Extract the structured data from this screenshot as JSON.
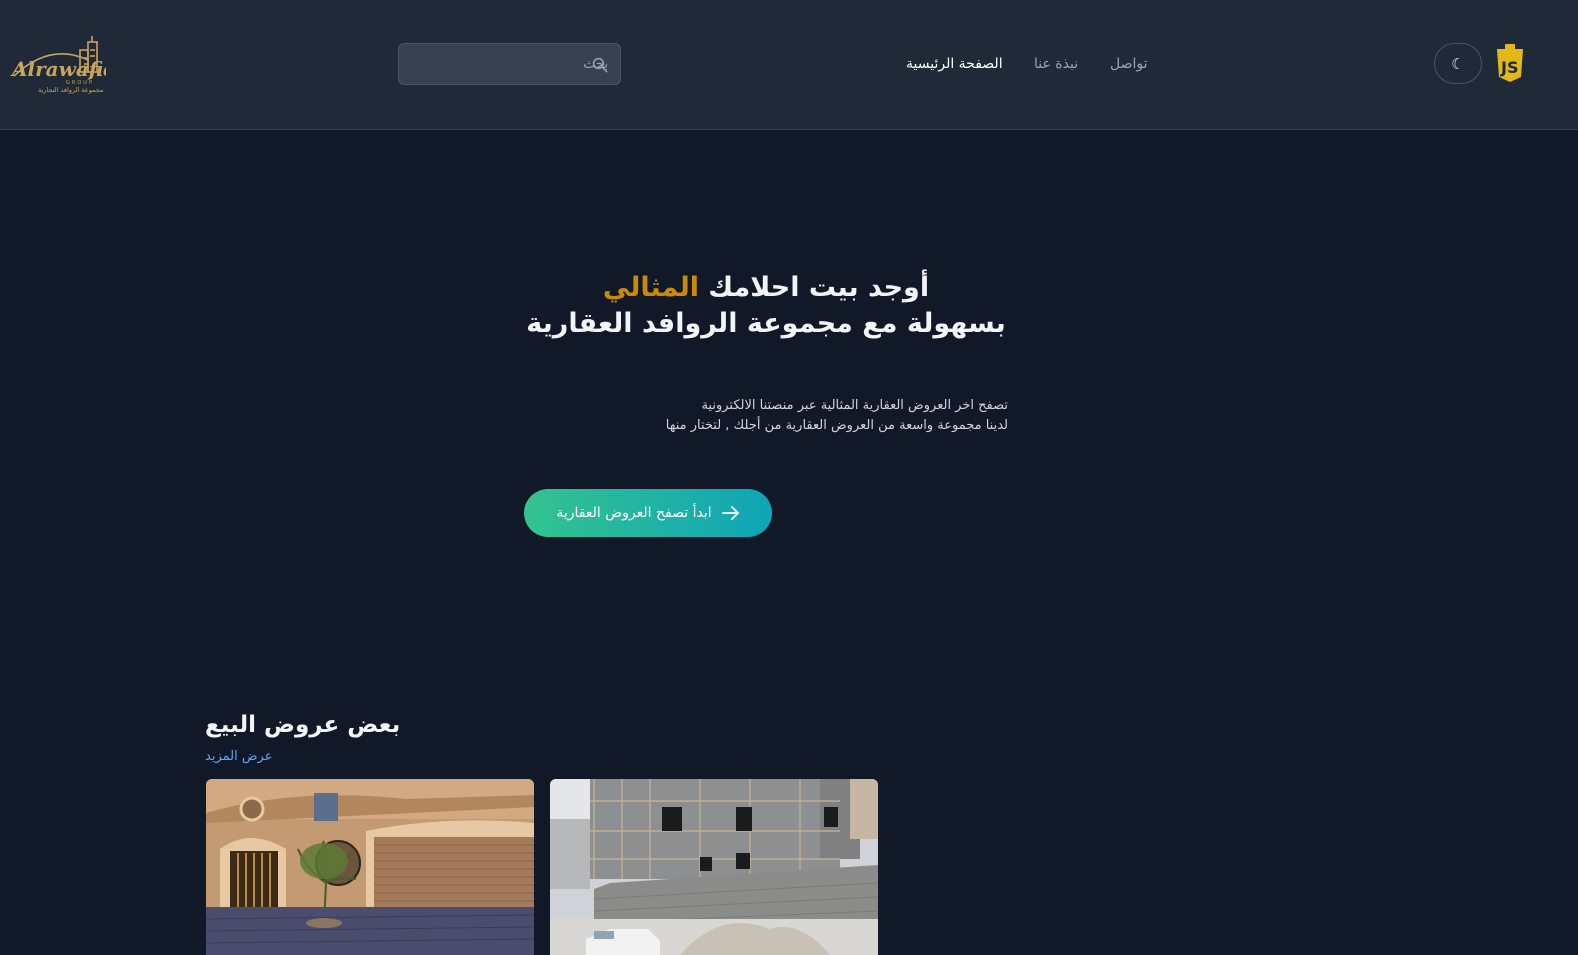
{
  "header": {
    "logo": {
      "text": "Alrawafid",
      "subtext": "GROUP",
      "arabic": "مجموعة الروافد التجارية",
      "color": "#c9a45a"
    },
    "search": {
      "placeholder": "بحث",
      "icon": "search-icon"
    },
    "nav": [
      {
        "label": "الصفحة الرئيسية",
        "active": true
      },
      {
        "label": "نبذة عنا",
        "active": false
      },
      {
        "label": "تواصل",
        "active": false
      }
    ],
    "theme_toggle": {
      "icon": "moon-icon",
      "glyph": "☾"
    },
    "js_badge": {
      "icon": "js-icon",
      "color": "#e5b81a"
    }
  },
  "hero": {
    "title_part1": "أوجد بيت احلامك",
    "title_accent": "المثالي",
    "title_line2": "بسهولة مع مجموعة الروافد العقارية",
    "subtitle_line1": "تصفح اخر العروض العقارية المثالية عبر منصتنا الالكترونية",
    "subtitle_line2": "لدينا مجموعة واسعة من العروض العقارية من أجلك , لتختار منها",
    "cta_label": "ابدأ تصفح العروض العقارية",
    "accent_color": "#ca8a04"
  },
  "listings": {
    "title": "بعض عروض البيع",
    "more_link": "عرض المزيد",
    "cards": [
      {
        "image": "villa-garage-photo"
      },
      {
        "image": "construction-building-photo"
      }
    ]
  },
  "colors": {
    "background": "#111827",
    "header": "#1f2937",
    "cta_gradient_start": "#34c38f",
    "cta_gradient_end": "#0ea5b7",
    "link": "#60a5fa"
  }
}
